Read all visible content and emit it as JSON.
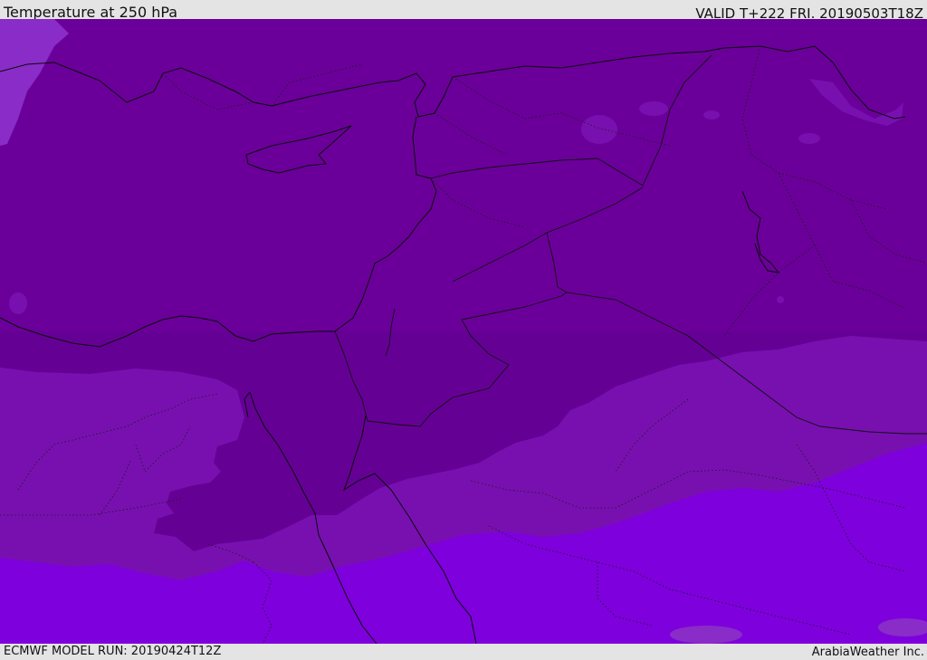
{
  "header": {
    "title": "Temperature at 250 hPa",
    "valid": "VALID T+222 FRI. 20190503T18Z"
  },
  "footer": {
    "model_run": "ECMWF MODEL RUN: 20190424T12Z",
    "credit": "ArabiaWeather Inc."
  },
  "colors": {
    "background": "#e4e4e4",
    "band_coldest": "#6a0099",
    "band_cold": "#650095",
    "band_mid": "#7810b0",
    "band_warm": "#7e00dc",
    "band_light": "#8a2cc8",
    "line": "#0a0a0a"
  },
  "map": {
    "field": "Temperature at 250 hPa",
    "region": "Eastern Mediterranean / Middle East"
  }
}
